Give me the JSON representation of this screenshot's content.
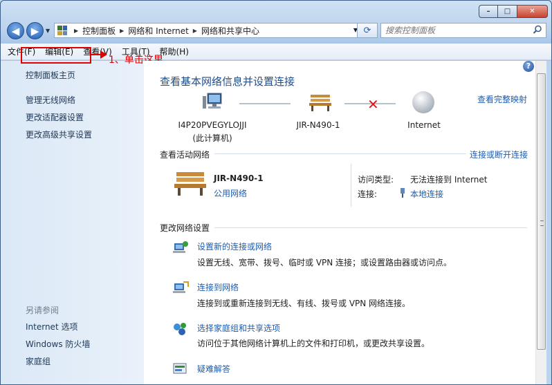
{
  "window": {
    "buttons": {
      "minimize": "–",
      "maximize": "□",
      "close": "✕"
    }
  },
  "address_bar": {
    "breadcrumbs": [
      "控制面板",
      "网络和 Internet",
      "网络和共享中心"
    ],
    "search_placeholder": "搜索控制面板"
  },
  "menu": [
    "文件(F)",
    "编辑(E)",
    "查看(V)",
    "工具(T)",
    "帮助(H)"
  ],
  "left_pane": {
    "home": "控制面板主页",
    "links": [
      "管理无线网络",
      "更改适配器设置",
      "更改高级共享设置"
    ],
    "see_also_title": "另请参阅",
    "see_also": [
      "Internet 选项",
      "Windows 防火墙",
      "家庭组"
    ]
  },
  "annotation": {
    "text": "1、单击这里",
    "color": "#e00000"
  },
  "main": {
    "title": "查看基本网络信息并设置连接",
    "full_map": "查看完整映射",
    "nodes": {
      "computer_name": "I4P20PVEGYLOJJI",
      "computer_sub": "(此计算机)",
      "network": "JIR-N490-1",
      "internet": "Internet"
    },
    "active_section": {
      "title": "查看活动网络",
      "action": "连接或断开连接",
      "network_name": "JIR-N490-1",
      "network_type": "公用网络",
      "access_type_label": "访问类型:",
      "access_type_value": "无法连接到 Internet",
      "connection_label": "连接:",
      "connection_value": "本地连接"
    },
    "change_section": {
      "title": "更改网络设置",
      "tasks": [
        {
          "link": "设置新的连接或网络",
          "desc": "设置无线、宽带、拨号、临时或 VPN 连接；或设置路由器或访问点。"
        },
        {
          "link": "连接到网络",
          "desc": "连接到或重新连接到无线、有线、拨号或 VPN 网络连接。"
        },
        {
          "link": "选择家庭组和共享选项",
          "desc": "访问位于其他网络计算机上的文件和打印机，或更改共享设置。"
        },
        {
          "link": "疑难解答",
          "desc": ""
        }
      ]
    }
  },
  "colors": {
    "link": "#1b5db3",
    "title": "#1e4d8c",
    "error": "#d61b1b"
  }
}
